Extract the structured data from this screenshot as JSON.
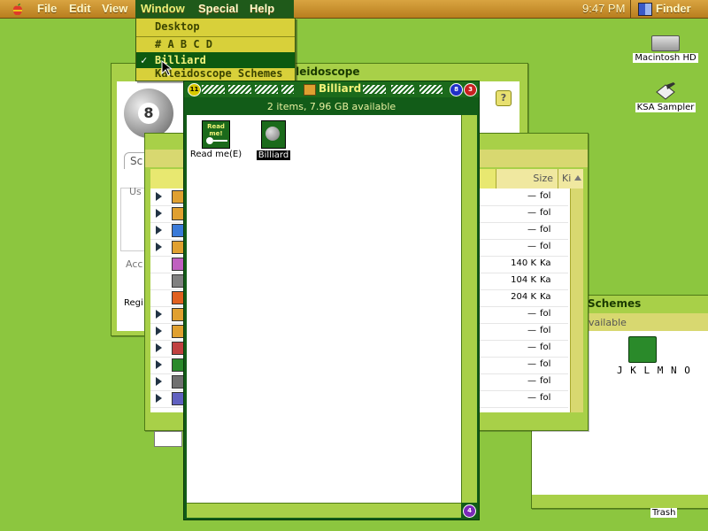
{
  "menubar": {
    "items": [
      "File",
      "Edit",
      "View",
      "Window",
      "Special",
      "Help"
    ],
    "clock": "9:47 PM",
    "app": "Finder"
  },
  "window_menu": {
    "items": [
      {
        "label": "Desktop",
        "checked": false
      },
      {
        "label": "# A B C D",
        "checked": false
      },
      {
        "label": "Billiard",
        "checked": true
      },
      {
        "label": "Kaleidoscope Schemes",
        "checked": false
      }
    ]
  },
  "desktop": {
    "icons": [
      {
        "label": "Macintosh HD"
      },
      {
        "label": "KSA Sampler"
      },
      {
        "label": "Trash"
      }
    ]
  },
  "kaleidoscope_window": {
    "title_fragment": "aleidoscope",
    "labels": [
      "Sc",
      "Us",
      "Acc",
      "Regi"
    ]
  },
  "list_window": {
    "headers": {
      "size": "Size",
      "kind": "Ki"
    },
    "rows": [
      {
        "size": "—",
        "kind": "fol",
        "expand": true
      },
      {
        "size": "—",
        "kind": "fol",
        "expand": true
      },
      {
        "size": "—",
        "kind": "fol",
        "expand": true
      },
      {
        "size": "—",
        "kind": "fol",
        "expand": true
      },
      {
        "size": "140 K",
        "kind": "Ka",
        "expand": false
      },
      {
        "size": "104 K",
        "kind": "Ka",
        "expand": false
      },
      {
        "size": "204 K",
        "kind": "Ka",
        "expand": false
      },
      {
        "size": "—",
        "kind": "fol",
        "expand": true
      },
      {
        "size": "—",
        "kind": "fol",
        "expand": true
      },
      {
        "size": "—",
        "kind": "fol",
        "expand": true
      },
      {
        "size": "—",
        "kind": "fol",
        "expand": true
      },
      {
        "size": "—",
        "kind": "fol",
        "expand": true
      },
      {
        "size": "—",
        "kind": "fol",
        "expand": true
      }
    ]
  },
  "schemes_window": {
    "title": "Schemes",
    "status": "vailable",
    "folder_label": "J K L M N O"
  },
  "billiard_window": {
    "title": "Billiard",
    "status": "2 items, 7.96 GB available",
    "files": [
      {
        "label": "Read me(E)",
        "selected": false
      },
      {
        "label": "Billiard",
        "selected": true
      }
    ],
    "readme_icon_text": "Read me!"
  },
  "colors": {
    "desktop": "#8cc63f",
    "menubar": "#d9a441",
    "menu_highlight": "#0d5a10",
    "window_frame": "#125c18"
  }
}
